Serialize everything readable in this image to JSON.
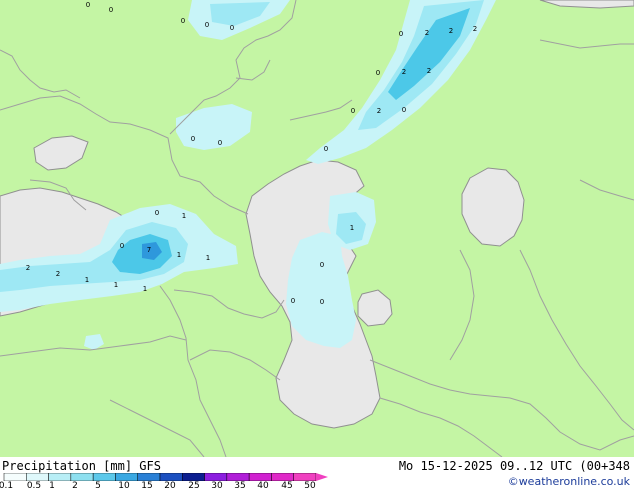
{
  "map": {
    "colors": {
      "land": "#c4f5a4",
      "water": "#e8e8e8",
      "border": "#a0a0a0",
      "coast": "#909090",
      "precip_light": "#c8f4f8",
      "precip_mid": "#9ee8f4",
      "precip_heavy": "#4cc8e8",
      "precip_core": "#2e98dc"
    },
    "value_labels": [
      "0",
      "0",
      "0",
      "0",
      "0",
      "2",
      "2",
      "2",
      "0",
      "2",
      "2",
      "0",
      "2",
      "0",
      "0",
      "0",
      "0",
      "0",
      "1",
      "0",
      "2",
      "7",
      "1",
      "1",
      "2",
      "1",
      "1",
      "1",
      "0",
      "1",
      "0",
      "0",
      "0"
    ]
  },
  "footer": {
    "title": "Precipitation [mm] GFS",
    "valid": "Mo 15-12-2025 09..12 UTC (00+348",
    "credit": "©weatheronline.co.uk"
  },
  "legend": {
    "ticks": [
      "0.1",
      "0.5",
      "1",
      "2",
      "5",
      "10",
      "15",
      "20",
      "25",
      "30",
      "35",
      "40",
      "45",
      "50"
    ],
    "colors": [
      "#f5fdfd",
      "#dff8fb",
      "#b8eef6",
      "#8ee0f0",
      "#5cc8ea",
      "#3aa8e2",
      "#2a80d6",
      "#1c50c0",
      "#0c1e90",
      "#8c1ee0",
      "#b01ed8",
      "#d020d0",
      "#e028c8",
      "#f040c0"
    ]
  }
}
